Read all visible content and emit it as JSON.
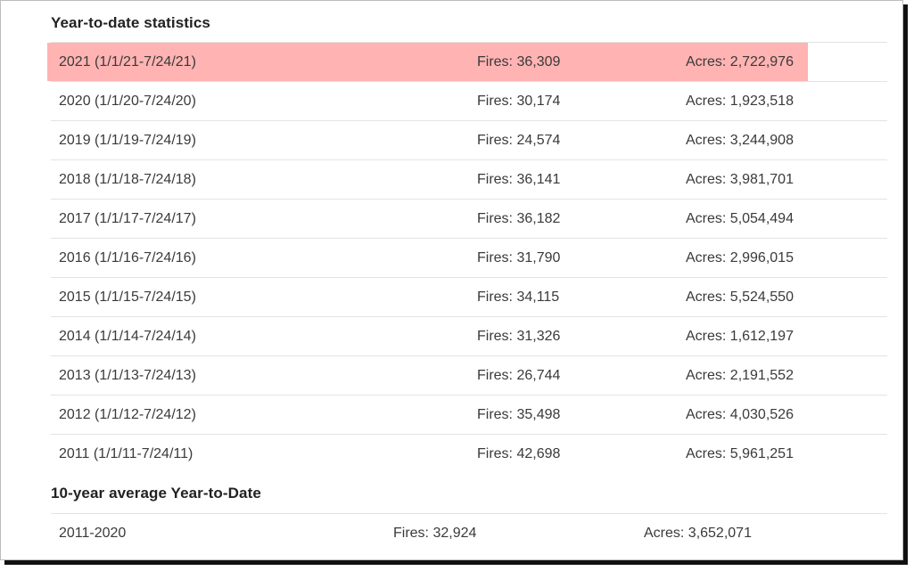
{
  "ytd": {
    "title": "Year-to-date statistics",
    "rows": [
      {
        "period": "2021 (1/1/21-7/24/21)",
        "fires": "Fires: 36,309",
        "acres": "Acres: 2,722,976",
        "highlighted": true
      },
      {
        "period": "2020 (1/1/20-7/24/20)",
        "fires": "Fires: 30,174",
        "acres": "Acres: 1,923,518"
      },
      {
        "period": "2019 (1/1/19-7/24/19)",
        "fires": "Fires: 24,574",
        "acres": "Acres: 3,244,908"
      },
      {
        "period": "2018 (1/1/18-7/24/18)",
        "fires": "Fires: 36,141",
        "acres": "Acres: 3,981,701"
      },
      {
        "period": "2017 (1/1/17-7/24/17)",
        "fires": "Fires: 36,182",
        "acres": "Acres: 5,054,494"
      },
      {
        "period": "2016 (1/1/16-7/24/16)",
        "fires": "Fires: 31,790",
        "acres": "Acres: 2,996,015"
      },
      {
        "period": "2015 (1/1/15-7/24/15)",
        "fires": "Fires: 34,115",
        "acres": "Acres: 5,524,550"
      },
      {
        "period": "2014 (1/1/14-7/24/14)",
        "fires": "Fires: 31,326",
        "acres": "Acres: 1,612,197"
      },
      {
        "period": "2013 (1/1/13-7/24/13)",
        "fires": "Fires: 26,744",
        "acres": "Acres: 2,191,552"
      },
      {
        "period": "2012 (1/1/12-7/24/12)",
        "fires": "Fires: 35,498",
        "acres": "Acres: 4,030,526"
      },
      {
        "period": "2011 (1/1/11-7/24/11)",
        "fires": "Fires: 42,698",
        "acres": "Acres: 5,961,251"
      }
    ]
  },
  "average": {
    "title": "10-year average Year-to-Date",
    "rows": [
      {
        "period": "2011-2020",
        "fires": "Fires: 32,924",
        "acres": "Acres: 3,652,071"
      }
    ]
  },
  "colors": {
    "highlight": "#ffb3b3",
    "divider": "#e3e3e3",
    "text": "#3a3a3a"
  }
}
